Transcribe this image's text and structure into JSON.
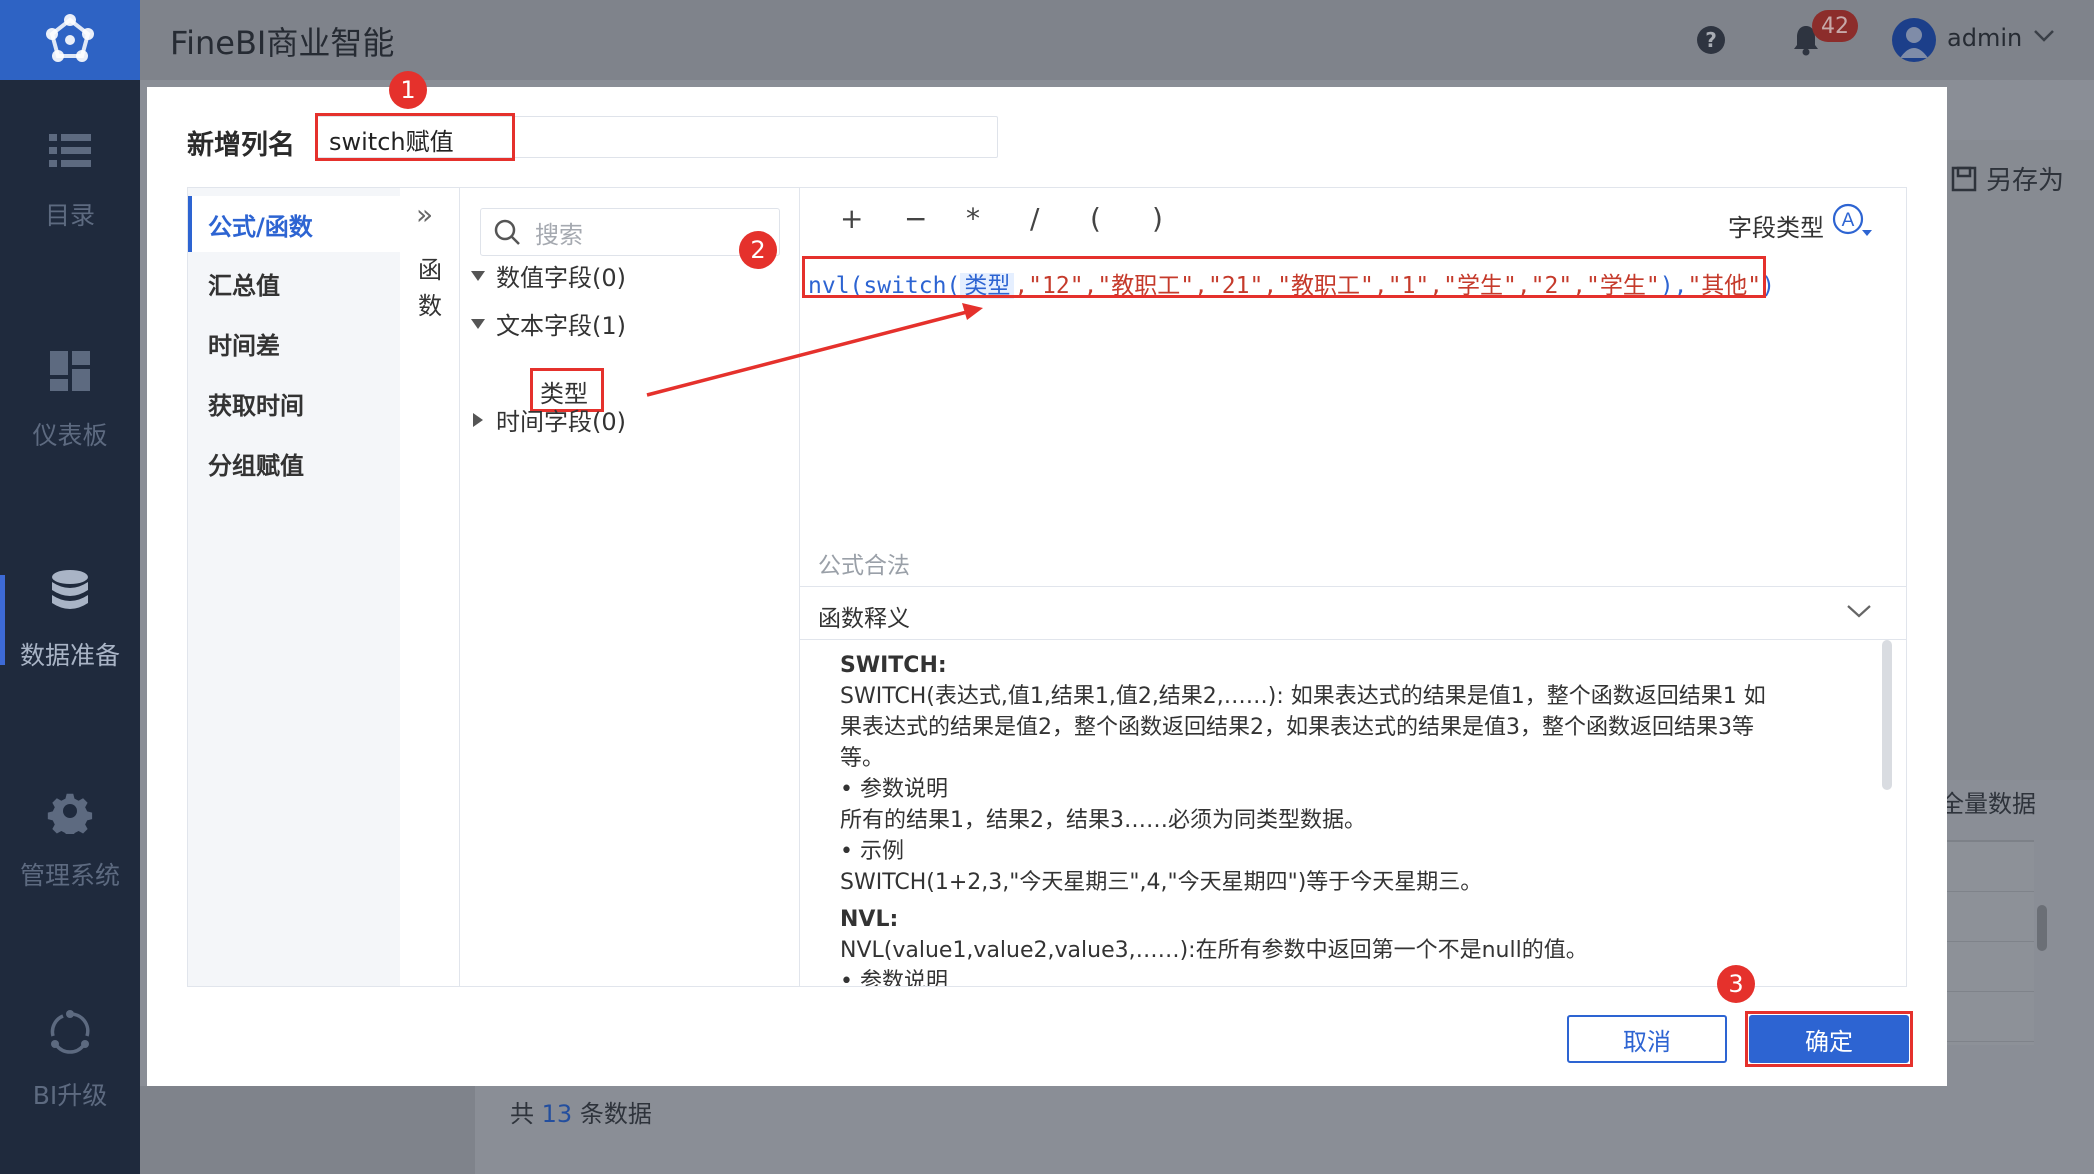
{
  "app": {
    "title": "FineBI商业智能"
  },
  "header": {
    "help_icon_glyph": "?",
    "notifications_count": "42",
    "user": "admin"
  },
  "sidebar": {
    "items": [
      {
        "label": "目录",
        "icon": "list-icon"
      },
      {
        "label": "仪表板",
        "icon": "dashboard-icon"
      },
      {
        "label": "数据准备",
        "icon": "database-icon",
        "active": true
      },
      {
        "label": "管理系统",
        "icon": "gear-icon"
      },
      {
        "label": "BI升级",
        "icon": "upgrade-icon"
      }
    ]
  },
  "background": {
    "save_as": "另存为",
    "full_data": "全量数据",
    "count_prefix": "共",
    "count_value": "13",
    "count_suffix": "条数据"
  },
  "dialog": {
    "name_label": "新增列名",
    "name_value": "switch赋值",
    "categories": [
      "公式/函数",
      "汇总值",
      "时间差",
      "获取时间",
      "分组赋值"
    ],
    "function_panel": {
      "expand_glyph": "»",
      "label_line1": "函",
      "label_line2": "数"
    },
    "search_placeholder": "搜索",
    "tree": [
      {
        "label": "数值字段(0)",
        "expanded": true
      },
      {
        "label": "文本字段(1)",
        "expanded": true,
        "children": [
          "类型"
        ]
      },
      {
        "label": "时间字段(0)",
        "expanded": false
      }
    ],
    "operators": [
      "+",
      "−",
      "*",
      "/",
      "(",
      ")"
    ],
    "field_type_label": "字段类型",
    "field_type_icon": "A",
    "formula": {
      "p1": "nvl(switch(",
      "field": "类型",
      "p2": ",\"12\",\"教职工\",\"21\",\"教职工\",\"1\",\"学生\",\"2\",\"学生\"",
      "p3": "),",
      "p4": "\"其他\"",
      "p5": ")"
    },
    "validity": "公式合法",
    "description_header": "函数释义",
    "description": {
      "switch_title": "SWITCH:",
      "switch_line1": "SWITCH(表达式,值1,结果1,值2,结果2,……): 如果表达式的结果是值1，整个函数返回结果1 如",
      "switch_line2": "果表达式的结果是值2，整个函数返回结果2，如果表达式的结果是值3，整个函数返回结果3等",
      "switch_line3": "等。",
      "param_header": "•  参数说明",
      "param_text": "所有的结果1，结果2，结果3……必须为同类型数据。",
      "example_header": "•  示例",
      "example_text": "SWITCH(1+2,3,\"今天星期三\",4,\"今天星期四\")等于今天星期三。",
      "nvl_title": "NVL:",
      "nvl_line1": "NVL(value1,value2,value3,……):在所有参数中返回第一个不是null的值。",
      "nvl_param_header": "• 参数说明"
    },
    "buttons": {
      "cancel": "取消",
      "ok": "确定"
    },
    "annotations": [
      "1",
      "2",
      "3"
    ]
  },
  "colors": {
    "accent": "#2d64d2",
    "highlight": "#e5312c",
    "sidebar_bg": "#1f2a3d",
    "logo_bg": "#2e63c4"
  }
}
